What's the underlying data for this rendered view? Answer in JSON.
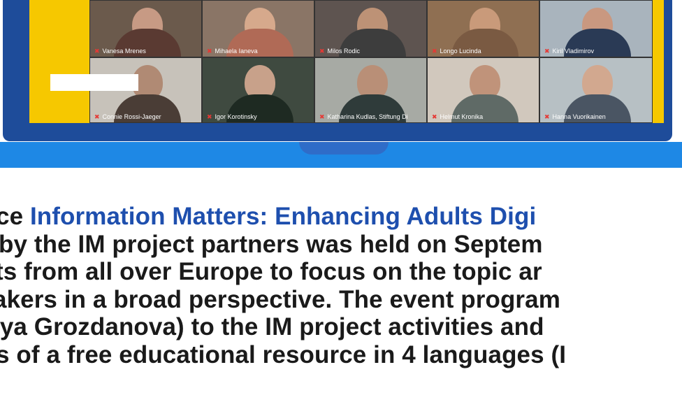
{
  "participants": [
    {
      "name": "Vanesa Mrenes",
      "bg": "#6b5a4c",
      "skin": "#c79a84",
      "shirt": "#5a3a32"
    },
    {
      "name": "Mihaela Ianeva",
      "bg": "#8a7566",
      "skin": "#d6a98c",
      "shirt": "#b06a56"
    },
    {
      "name": "Milos Rodic",
      "bg": "#5e5450",
      "skin": "#bd9276",
      "shirt": "#3d3d3d"
    },
    {
      "name": "Longo Lucinda",
      "bg": "#8f6f52",
      "skin": "#c99a7a",
      "shirt": "#7a5a42"
    },
    {
      "name": "Kiril Vladimirov",
      "bg": "#a9b4bd",
      "skin": "#c99880",
      "shirt": "#2a3a55"
    },
    {
      "name": "Connie Rossi-Jaeger",
      "bg": "#c7c2ba",
      "skin": "#b08a74",
      "shirt": "#4a3d36"
    },
    {
      "name": "Igor Korotinsky",
      "bg": "#3f4a40",
      "skin": "#c8a18a",
      "shirt": "#1e2a22"
    },
    {
      "name": "Katharina Kudlas, Stiftung Di",
      "bg": "#a7aaa4",
      "skin": "#b98f77",
      "shirt": "#2f3b3a"
    },
    {
      "name": "Helmut Kronika",
      "bg": "#d1c8bd",
      "skin": "#c0937a",
      "shirt": "#5f6a66"
    },
    {
      "name": "Hanna Vuorikainen",
      "bg": "#b7c0c4",
      "skin": "#d2a88f",
      "shirt": "#4a5563"
    }
  ],
  "article": {
    "l1_pre": "ce ",
    "l1_link": "Information Matters: Enhancing Adults Digi",
    "l2": "by the IM project partners was held on Septem",
    "l3": "ts from all over Europe to focus on the topic ar",
    "l4": "akers in a broad perspective. The event program",
    "l5": "iya Grozdanova) to the IM project activities and",
    "l6": "s of a free educational resource in 4 languages (I"
  }
}
